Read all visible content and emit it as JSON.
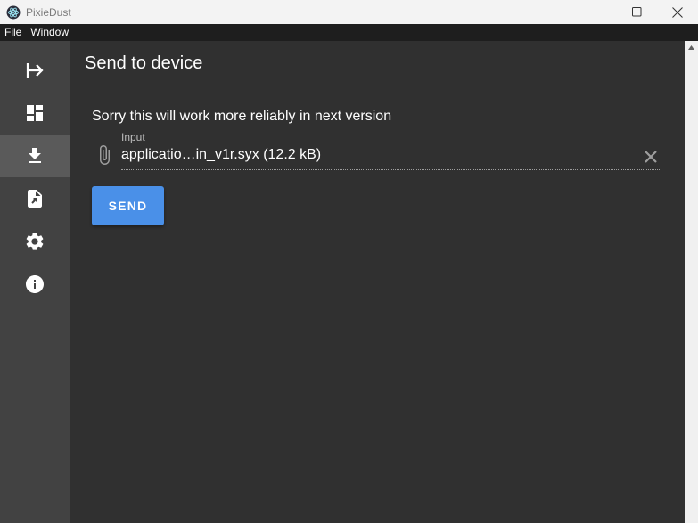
{
  "window": {
    "title": "PixieDust",
    "controls": [
      "minimize-icon",
      "maximize-icon",
      "close-icon"
    ]
  },
  "menu": {
    "items": [
      {
        "label": "File"
      },
      {
        "label": "Window"
      }
    ]
  },
  "sidebar": {
    "items": [
      {
        "icon": "login-arrow-icon",
        "active": false
      },
      {
        "icon": "dashboard-icon",
        "active": false
      },
      {
        "icon": "download-icon",
        "active": true
      },
      {
        "icon": "file-export-icon",
        "active": false
      },
      {
        "icon": "settings-gear-icon",
        "active": false
      },
      {
        "icon": "info-icon",
        "active": false
      }
    ]
  },
  "main": {
    "title": "Send to device",
    "notice": "Sorry this will work more reliably in next version",
    "file_input": {
      "label": "Input",
      "value": "applicatio…in_v1r.syx (12.2 kB)",
      "icon": "paperclip-icon"
    },
    "send_label": "SEND"
  },
  "colors": {
    "background": "#303030",
    "sidebar": "#424242",
    "sidebar_active": "#5a5a5a",
    "accent": "#4a90e8",
    "menubar": "#1e1e1e"
  }
}
